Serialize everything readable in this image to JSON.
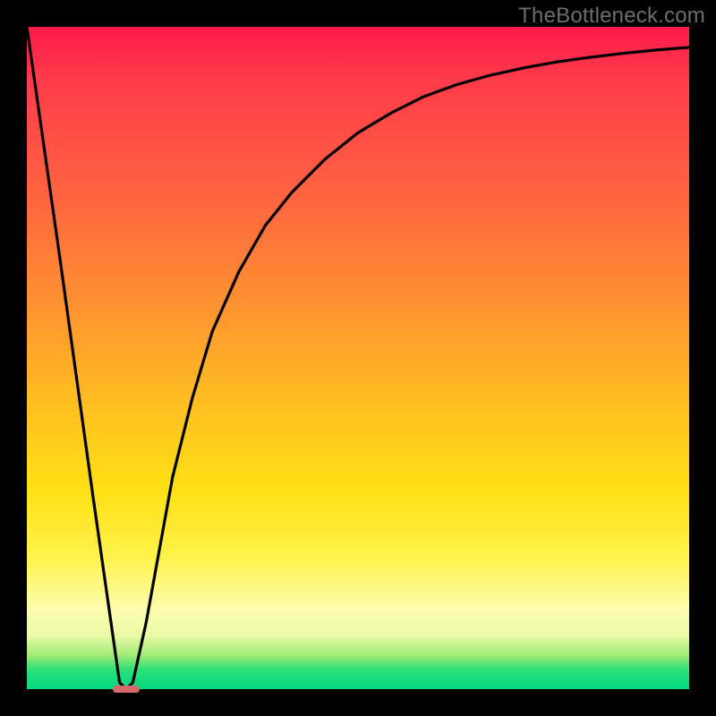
{
  "watermark": "TheBottleneck.com",
  "chart_data": {
    "type": "line",
    "title": "",
    "xlabel": "",
    "ylabel": "",
    "xlim": [
      0,
      100
    ],
    "ylim": [
      0,
      100
    ],
    "grid": false,
    "legend": false,
    "series": [
      {
        "name": "bottleneck-curve",
        "x": [
          0,
          5,
          10,
          14,
          15,
          16,
          18,
          20,
          22,
          25,
          28,
          32,
          36,
          40,
          45,
          50,
          55,
          60,
          65,
          70,
          75,
          80,
          85,
          90,
          95,
          100
        ],
        "y": [
          100,
          65,
          29,
          1,
          0,
          1,
          10,
          21,
          32,
          44,
          54,
          63,
          70,
          75,
          80,
          84,
          87,
          89.5,
          91.3,
          92.7,
          93.8,
          94.7,
          95.4,
          96.0,
          96.5,
          96.9
        ]
      }
    ],
    "marker": {
      "x": 15,
      "y": 0,
      "width_frac": 0.04,
      "height_frac": 0.012
    },
    "background_gradient": {
      "top": "#ff1a4a",
      "mid": "#ffe015",
      "bottom": "#00d980"
    }
  }
}
